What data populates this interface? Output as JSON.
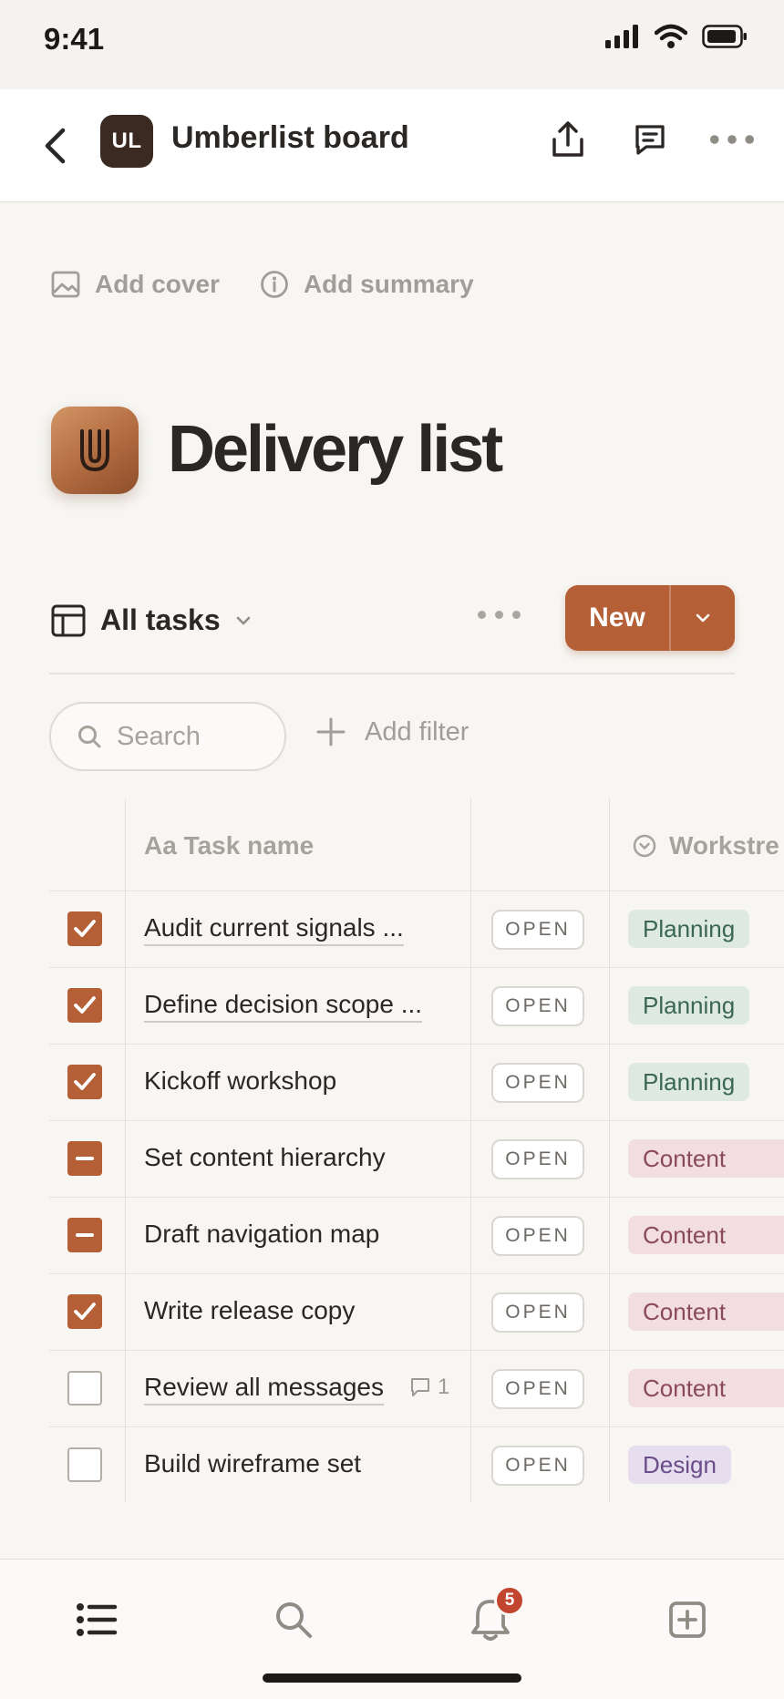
{
  "status_bar": {
    "time": "9:41"
  },
  "header": {
    "workspace_initials": "UL",
    "workspace_title": "Umberlist board"
  },
  "page_tools": {
    "add_cover": "Add cover",
    "add_summary": "Add summary"
  },
  "page": {
    "title": "Delivery list",
    "icon_letter": "U"
  },
  "view": {
    "name": "All tasks",
    "new_label": "New"
  },
  "filters": {
    "search_placeholder": "Search",
    "add_filter": "Add filter"
  },
  "table": {
    "columns": {
      "task_name": "Aa Task name",
      "workstream": "Workstre"
    },
    "rows": [
      {
        "task": "Audit current signals ...",
        "status": "OPEN",
        "workstream": "Planning",
        "check": "checked"
      },
      {
        "task": "Define decision scope ...",
        "status": "OPEN",
        "workstream": "Planning",
        "check": "checked"
      },
      {
        "task": "Kickoff workshop",
        "status": "OPEN",
        "workstream": "Planning",
        "check": "checked"
      },
      {
        "task": "Set content hierarchy",
        "status": "OPEN",
        "workstream": "Content",
        "check": "partial"
      },
      {
        "task": "Draft navigation map",
        "status": "OPEN",
        "workstream": "Content",
        "check": "partial"
      },
      {
        "task": "Write release copy",
        "status": "OPEN",
        "workstream": "Content",
        "check": "checked"
      },
      {
        "task": "Review all messages",
        "status": "OPEN",
        "workstream": "Content",
        "check": "unchecked",
        "comments": "1"
      },
      {
        "task": "Build wireframe set",
        "status": "OPEN",
        "workstream": "Design",
        "check": "unchecked"
      }
    ]
  },
  "tabbar": {
    "notification_count": "5"
  },
  "colors": {
    "accent": "#b55f37",
    "background": "#f7f6f3"
  }
}
